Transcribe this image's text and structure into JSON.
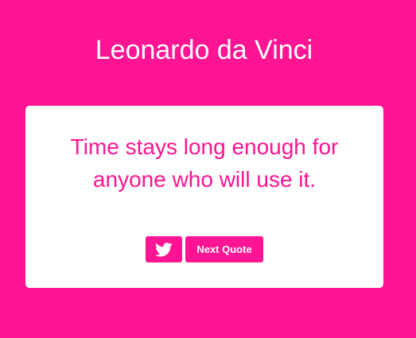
{
  "quote": {
    "author": "Leonardo da Vinci",
    "text": "Time stays long enough for anyone who will use it."
  },
  "actions": {
    "tweet_icon": "twitter-bird-icon",
    "next_label": "Next Quote"
  },
  "colors": {
    "background": "#ff1493",
    "card": "#ffffff",
    "accent": "#ff1493",
    "button_text": "#ffffff"
  }
}
